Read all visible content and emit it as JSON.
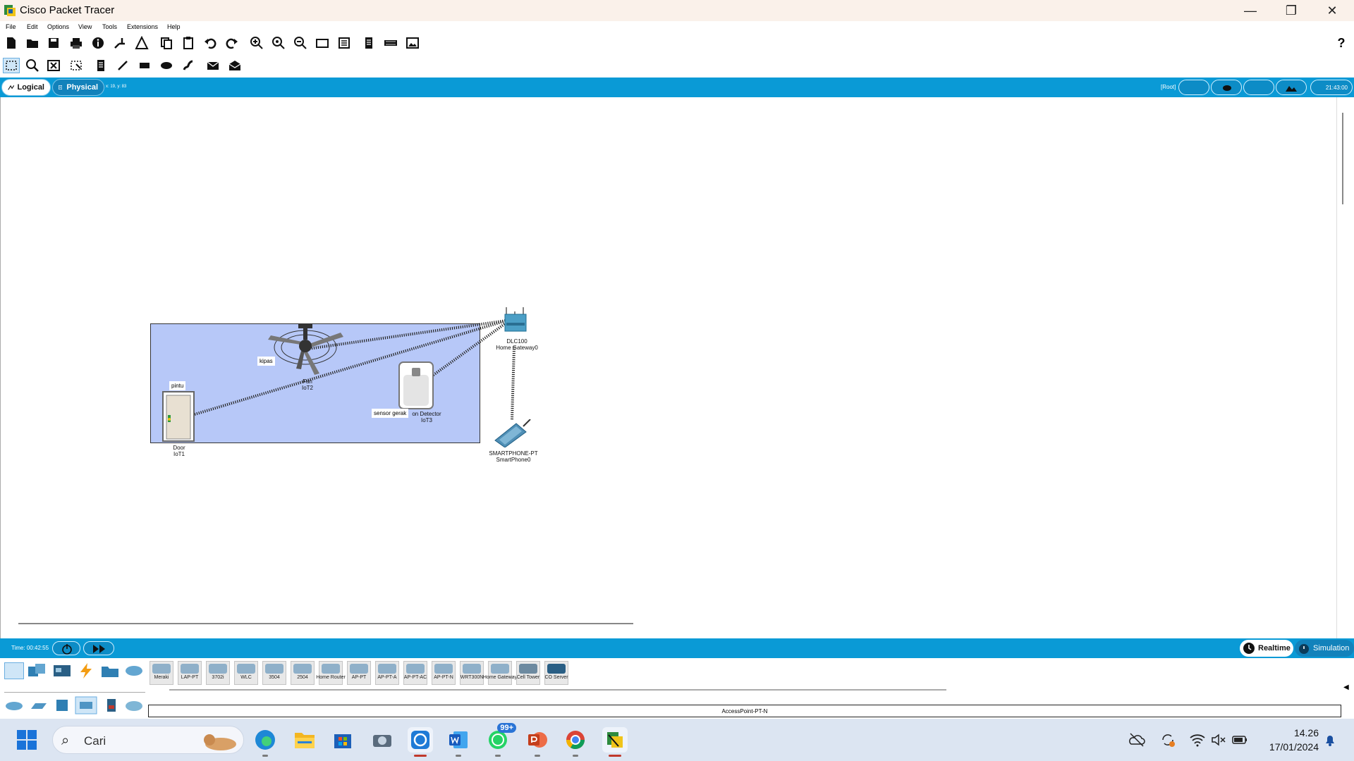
{
  "window": {
    "title": "Cisco Packet Tracer"
  },
  "menu": [
    "File",
    "Edit",
    "Options",
    "View",
    "Tools",
    "Extensions",
    "Help"
  ],
  "toolbar1_icons": [
    "new-file-icon",
    "open-folder-icon",
    "save-icon",
    "print-icon",
    "info-icon",
    "network-wizard-icon",
    "activity-wizard-icon",
    "copy-icon",
    "paste-icon",
    "undo-icon",
    "redo-icon",
    "zoom-in-icon",
    "zoom-reset-icon",
    "zoom-out-icon",
    "drawing-palette-icon",
    "custom-devices-icon",
    "pdu-list-icon",
    "cluster-icon",
    "image-icon"
  ],
  "toolbar2_icons": [
    "select-icon",
    "inspect-icon",
    "delete-icon",
    "resize-icon",
    "note-icon",
    "line-icon",
    "rectangle-icon",
    "ellipse-icon",
    "freeform-icon",
    "simple-pdu-icon",
    "complex-pdu-icon"
  ],
  "tabs": {
    "logical": "Logical",
    "physical": "Physical"
  },
  "coords": "x: 19, y: 83",
  "root_label": "[Root]",
  "clock_display": "21:43:00",
  "canvas": {
    "notes": {
      "fan": "kipas",
      "door": "pintu",
      "sensor": "sensor gerak"
    },
    "devices": {
      "fan": {
        "line1": "Fan",
        "line2": "IoT2"
      },
      "door": {
        "line1": "Door",
        "line2": "IoT1"
      },
      "motion": {
        "line1": "on Detector",
        "line2": "IoT3"
      },
      "gateway": {
        "line1": "DLC100",
        "line2": "Home Gateway0"
      },
      "phone": {
        "line1": "SMARTPHONE-PT",
        "line2": "SmartPhone0"
      }
    }
  },
  "bottom": {
    "time": "Time: 00:42:55",
    "realtime": "Realtime",
    "simulation": "Simulation"
  },
  "device_list": [
    "Meraki",
    "LAP-PT",
    "3702i",
    "WLC",
    "3504",
    "2504",
    "Home Router",
    "AP-PT",
    "AP-PT-A",
    "AP-PT-AC",
    "AP-PT-N",
    "WRT300N",
    "Home Gateway",
    "Cell Tower",
    "CO Server"
  ],
  "selected_device": "AccessPoint-PT-N",
  "taskbar": {
    "search_placeholder": "Cari",
    "whatsapp_badge": "99+",
    "time": "14.26",
    "date": "17/01/2024"
  },
  "colors": {
    "accent_blue": "#0a9ad6",
    "room_fill": "#b7c8f8"
  }
}
